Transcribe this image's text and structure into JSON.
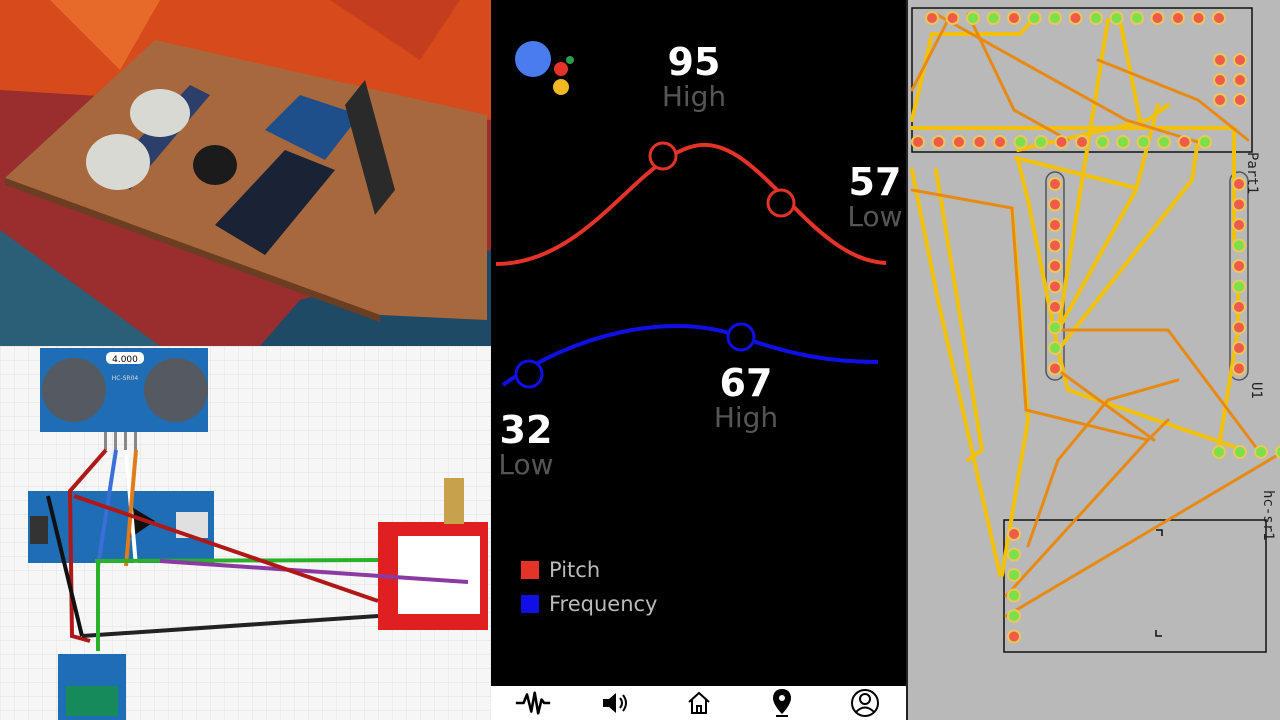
{
  "app": {
    "colors": {
      "pitch": "#e4342a",
      "frequency": "#1010e6",
      "background": "#000000",
      "value_text": "#ffffff",
      "label_text": "#555555"
    },
    "pitch_peak": {
      "value": "95",
      "label": "High"
    },
    "pitch_end": {
      "value": "57",
      "label": "Low"
    },
    "frequency_start": {
      "value": "32",
      "label": "Low"
    },
    "frequency_peak": {
      "value": "67",
      "label": "High"
    },
    "legend": {
      "pitch_label": "Pitch",
      "frequency_label": "Frequency"
    },
    "nav": [
      "waveform-icon",
      "speaker-icon",
      "home-icon",
      "location-pin-icon",
      "profile-icon"
    ]
  },
  "pcb": {
    "labels": {
      "part1": "Part1",
      "u1": "U1",
      "hc_sr1": "hc-sr1"
    }
  },
  "schematic": {
    "sensor_label": "4.000",
    "sensor_model": "HC-SR04"
  }
}
